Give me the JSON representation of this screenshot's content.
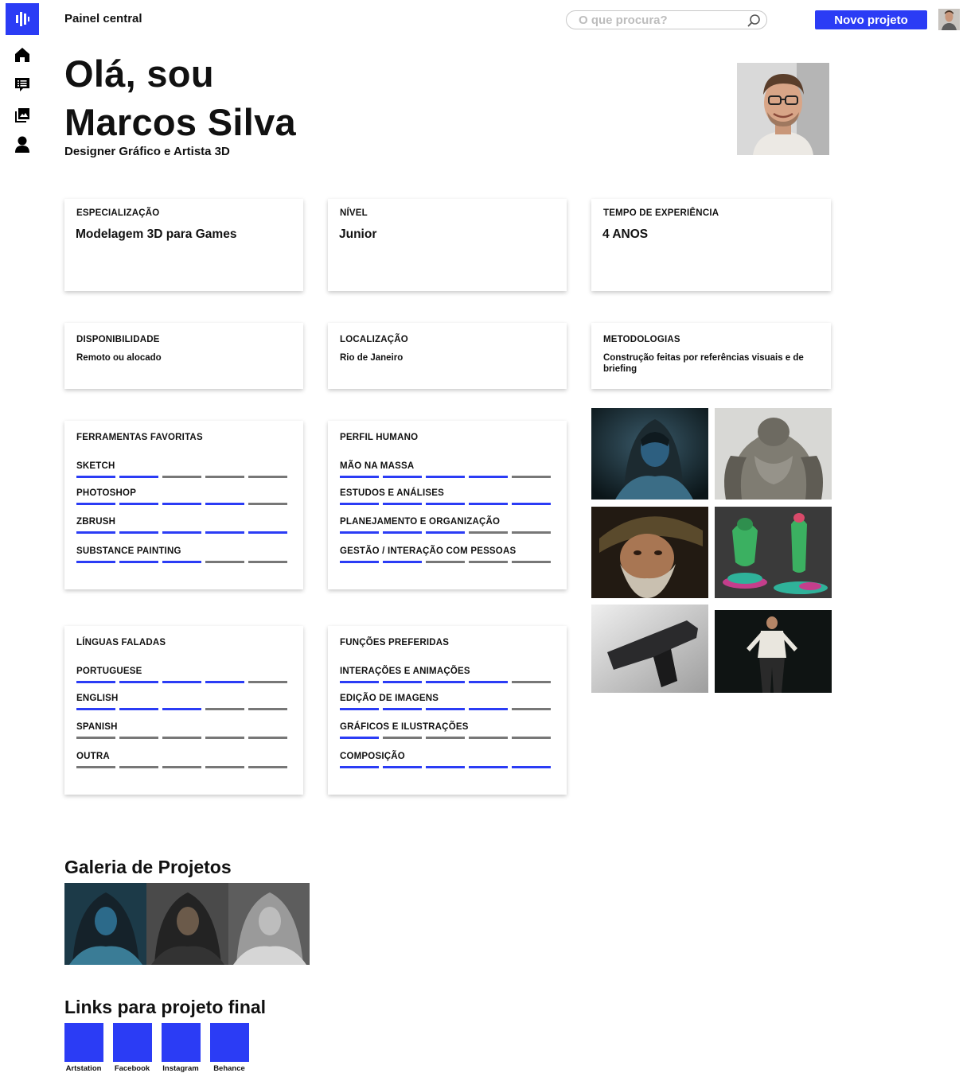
{
  "header": {
    "title": "Painel central",
    "search_placeholder": "O que procura?",
    "new_project_label": "Novo projeto"
  },
  "sidebar": {
    "items": [
      {
        "icon": "home-icon"
      },
      {
        "icon": "list-icon"
      },
      {
        "icon": "gallery-icon"
      },
      {
        "icon": "user-icon"
      }
    ]
  },
  "hero": {
    "greeting_line1": "Olá, sou",
    "greeting_line2": "Marcos Silva",
    "role": "Designer Gráfico e Artista 3D"
  },
  "info_cards": {
    "specialization": {
      "label": "ESPECIALIZAÇÃO",
      "value": "Modelagem 3D para Games"
    },
    "level": {
      "label": "NÍVEL",
      "value": "Junior"
    },
    "experience": {
      "label": "TEMPO DE EXPERIÊNCIA",
      "value": "4 ANOS"
    },
    "availability": {
      "label": "DISPONIBILIDADE",
      "value": "Remoto ou alocado"
    },
    "location": {
      "label": "LOCALIZAÇÃO",
      "value": "Rio de Janeiro"
    },
    "methodologies": {
      "label": "METODOLOGIAS",
      "value": "Construção feitas por referências visuais e de briefing"
    }
  },
  "skills": {
    "tools": {
      "label": "FERRAMENTAS FAVORITAS",
      "items": [
        {
          "name": "SKETCH",
          "level": 2,
          "max": 5
        },
        {
          "name": "PHOTOSHOP",
          "level": 4,
          "max": 5
        },
        {
          "name": "ZBRUSH",
          "level": 5,
          "max": 5
        },
        {
          "name": "SUBSTANCE PAINTING",
          "level": 3,
          "max": 5
        }
      ]
    },
    "human": {
      "label": "PERFIL HUMANO",
      "items": [
        {
          "name": "MÃO NA MASSA",
          "level": 4,
          "max": 5
        },
        {
          "name": "ESTUDOS E ANÁLISES",
          "level": 5,
          "max": 5
        },
        {
          "name": "PLANEJAMENTO E ORGANIZAÇÃO",
          "level": 3,
          "max": 5
        },
        {
          "name": "GESTÃO / INTERAÇÃO COM PESSOAS",
          "level": 2,
          "max": 5
        }
      ]
    },
    "languages": {
      "label": "LÍNGUAS FALADAS",
      "items": [
        {
          "name": "PORTUGUESE",
          "level": 4,
          "max": 5
        },
        {
          "name": "ENGLISH",
          "level": 3,
          "max": 5
        },
        {
          "name": "SPANISH",
          "level": 0,
          "max": 5
        },
        {
          "name": "OUTRA",
          "level": 0,
          "max": 5
        }
      ]
    },
    "roles": {
      "label": "FUNÇÕES PREFERIDAS",
      "items": [
        {
          "name": "INTERAÇÕES E ANIMAÇÕES",
          "level": 4,
          "max": 5
        },
        {
          "name": "EDIÇÃO DE IMAGENS",
          "level": 4,
          "max": 5
        },
        {
          "name": "GRÁFICOS E ILUSTRAÇÕES",
          "level": 1,
          "max": 5
        },
        {
          "name": "COMPOSIÇÃO",
          "level": 5,
          "max": 5
        }
      ]
    }
  },
  "gallery": {
    "title": "Galeria de Projetos"
  },
  "links": {
    "title": "Links para projeto final",
    "items": [
      {
        "label": "Artstation"
      },
      {
        "label": "Facebook"
      },
      {
        "label": "Instagram"
      },
      {
        "label": "Behance"
      }
    ]
  },
  "colors": {
    "accent": "#2b3cf5",
    "bar_off": "#777777"
  }
}
